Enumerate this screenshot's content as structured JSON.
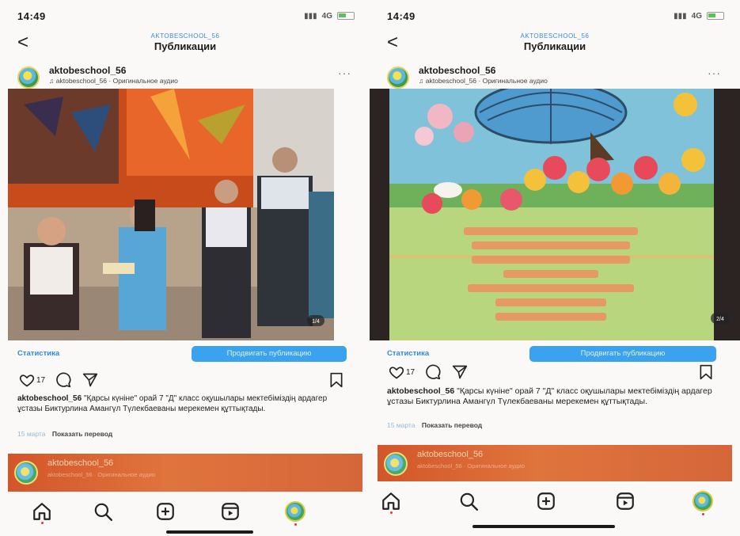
{
  "phones": [
    {
      "status": {
        "time": "14:49",
        "network": "4G"
      },
      "nav": {
        "account_tag": "AKTOBESCHOOL_56",
        "title": "Публикации"
      },
      "post": {
        "username": "aktobeschool_56",
        "audio": "aktobeschool_56 · Оригинальное аудио",
        "likes": "17",
        "stats_label": "Статистика",
        "promote_label": "Продвигать публикацию",
        "caption_user": "aktobeschool_56",
        "caption_text": "\"Қарсы күніне\" орай 7 \"Д\" класс оқушылары мектебіміздің ардагер ұстазы Биктурлина Амангүл Түлекбаеваны мерекемен құттықтады.",
        "date": "15 марта",
        "translate": "Показать перевод",
        "photo_counter": "1/4"
      },
      "next_post": {
        "username": "aktobeschool_56",
        "audio": "aktobeschool_56 · Оригинальное аудио"
      }
    },
    {
      "status": {
        "time": "14:49",
        "network": "4G"
      },
      "nav": {
        "account_tag": "AKTOBESCHOOL_56",
        "title": "Публикации"
      },
      "post": {
        "username": "aktobeschool_56",
        "audio": "aktobeschool_56 · Оригинальное аудио",
        "likes": "17",
        "stats_label": "Статистика",
        "promote_label": "Продвигать публикацию",
        "caption_user": "aktobeschool_56",
        "caption_text": "\"Қарсы күніне\" орай 7 \"Д\" класс оқушылары мектебіміздің ардагер ұстазы Биктурлина Амангүл Түлекбаеваны мерекемен құттықтады.",
        "date": "15 марта",
        "translate": "Показать перевод",
        "photo_counter": "2/4"
      },
      "next_post": {
        "username": "aktobeschool_56",
        "audio": "aktobeschool_56 · Оригинальное аудио"
      }
    }
  ],
  "colors": {
    "accent": "#3aa2ef",
    "link": "#2f8ad9",
    "next_post_bg": "#d8612f"
  },
  "icons": [
    "back-chevron-icon",
    "more-icon",
    "heart-icon",
    "comment-icon",
    "share-icon",
    "bookmark-icon",
    "home-icon",
    "search-icon",
    "create-icon",
    "reels-icon",
    "profile-icon"
  ]
}
